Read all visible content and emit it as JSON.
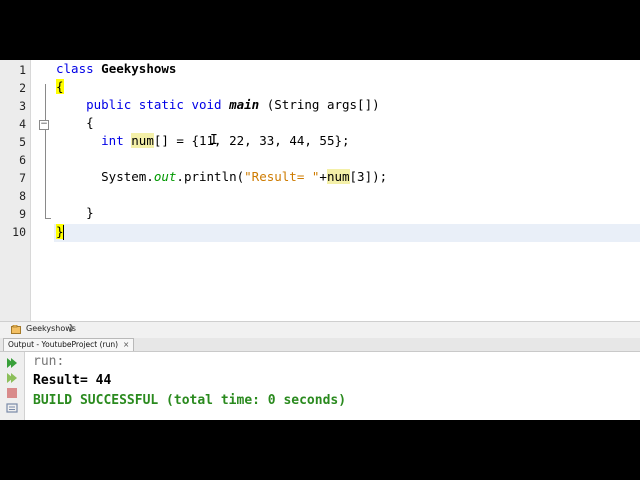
{
  "editor": {
    "line_numbers": [
      "1",
      "2",
      "3",
      "4",
      "5",
      "6",
      "7",
      "8",
      "9",
      "10"
    ],
    "line1": {
      "kw": "class",
      "name": "Geekyshows"
    },
    "line2": {
      "brace": "{"
    },
    "line3": {
      "mods": "public static void",
      "method": "main",
      "params": "(String args[])"
    },
    "line4": {
      "brace": "{"
    },
    "line5": {
      "type": "int",
      "var": "num",
      "rest_a": "[] = {1",
      "rest_b": "1, 22, 33, 44, 55};"
    },
    "line7": {
      "prefix": "System.",
      "field": "out",
      "call": ".println(",
      "str": "\"Result= \"",
      "plus": "+",
      "var": "num",
      "rest": "[3]);"
    },
    "line9": {
      "brace": "}"
    },
    "line10": {
      "brace": "}"
    }
  },
  "breadcrumb": {
    "label": "Geekyshows"
  },
  "output": {
    "tab_label": "Output - YoutubeProject (run)",
    "tab_close": "×",
    "lines": {
      "run": "run:",
      "result": "Result= 44",
      "build": "BUILD SUCCESSFUL (total time: 0 seconds)"
    }
  },
  "colors": {
    "keyword": "#0000e6",
    "string": "#ce7b00",
    "field": "#009900",
    "highlight": "#f4f0a8",
    "success": "#2a8a1e"
  }
}
